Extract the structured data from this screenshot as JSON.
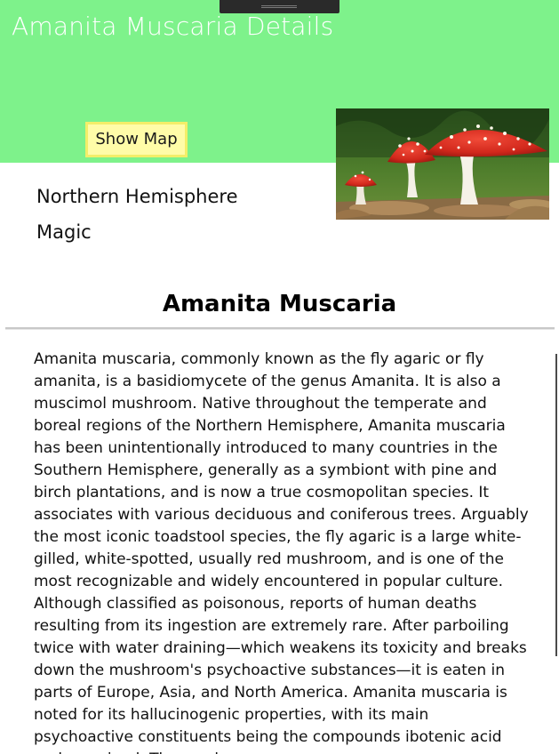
{
  "header": {
    "title": "Amanita Muscaria Details",
    "background_color": "#7ef28b",
    "show_map_label": "Show Map",
    "button_color": "#fffca8",
    "button_border_color": "#f3ee69"
  },
  "image": {
    "alt": "Amanita muscaria mushrooms",
    "icon": "mushroom-photo"
  },
  "details": {
    "region": "Northern Hemisphere",
    "type": "Magic"
  },
  "article": {
    "heading": "Amanita Muscaria",
    "body": "Amanita muscaria, commonly known as the fly agaric or fly amanita, is a basidiomycete of the genus Amanita. It is also a muscimol mushroom. Native throughout the temperate and boreal regions of the Northern Hemisphere, Amanita muscaria has been unintentionally introduced to many countries in the Southern Hemisphere, generally as a symbiont with pine and birch plantations, and is now a true cosmopolitan species. It associates with various deciduous and coniferous trees. Arguably the most iconic toadstool species, the fly agaric is a large white-gilled, white-spotted, usually red mushroom, and is one of the most recognizable and widely encountered in popular culture. Although classified as poisonous, reports of human deaths resulting from its ingestion are extremely rare. After parboiling twice with water draining—which weakens its toxicity and breaks down the mushroom's psychoactive substances—it is eaten in parts of Europe, Asia, and North America. Amanita muscaria is noted for its hallucinogenic properties, with its main psychoactive constituents being the compounds ibotenic acid and muscimol. The mushroom"
  }
}
